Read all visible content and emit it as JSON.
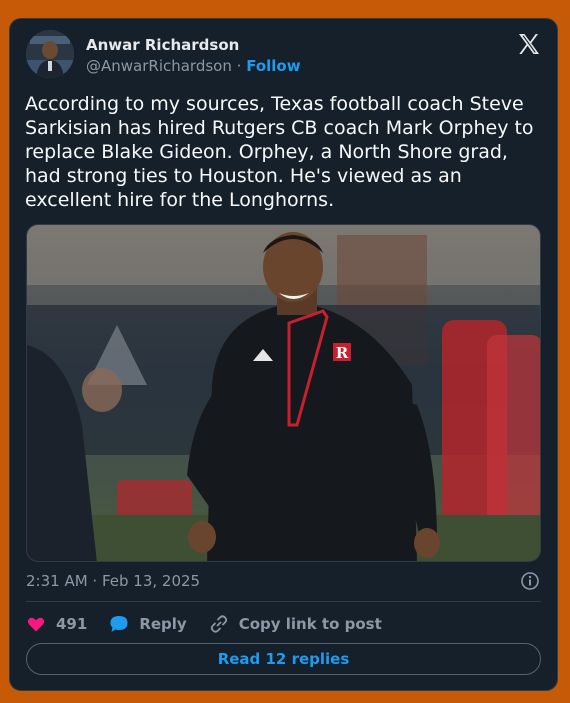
{
  "tweet": {
    "author_name": "Anwar Richardson",
    "handle": "@AnwarRichardson",
    "separator": "·",
    "follow_label": "Follow",
    "text": "According to my sources, Texas football coach Steve Sarkisian has hired Rutgers CB coach Mark Orphey to replace Blake Gideon. Orphey, a North Shore grad, had strong ties to Houston. He's viewed as an excellent hire for the Longhorns.",
    "timestamp": "2:31 AM · Feb 13, 2025",
    "like_count": "491",
    "reply_label": "Reply",
    "copy_link_label": "Copy link to post",
    "read_replies_label": "Read 12 replies"
  },
  "icons": {
    "logo": "x-logo-icon",
    "info": "info-icon",
    "like": "heart-icon",
    "reply": "speech-bubble-icon",
    "copy": "link-icon"
  },
  "colors": {
    "page_background": "#c75a06",
    "card_background": "#15202b",
    "accent": "#1d9bf0",
    "like": "#f91880",
    "muted": "#8b98a5"
  }
}
